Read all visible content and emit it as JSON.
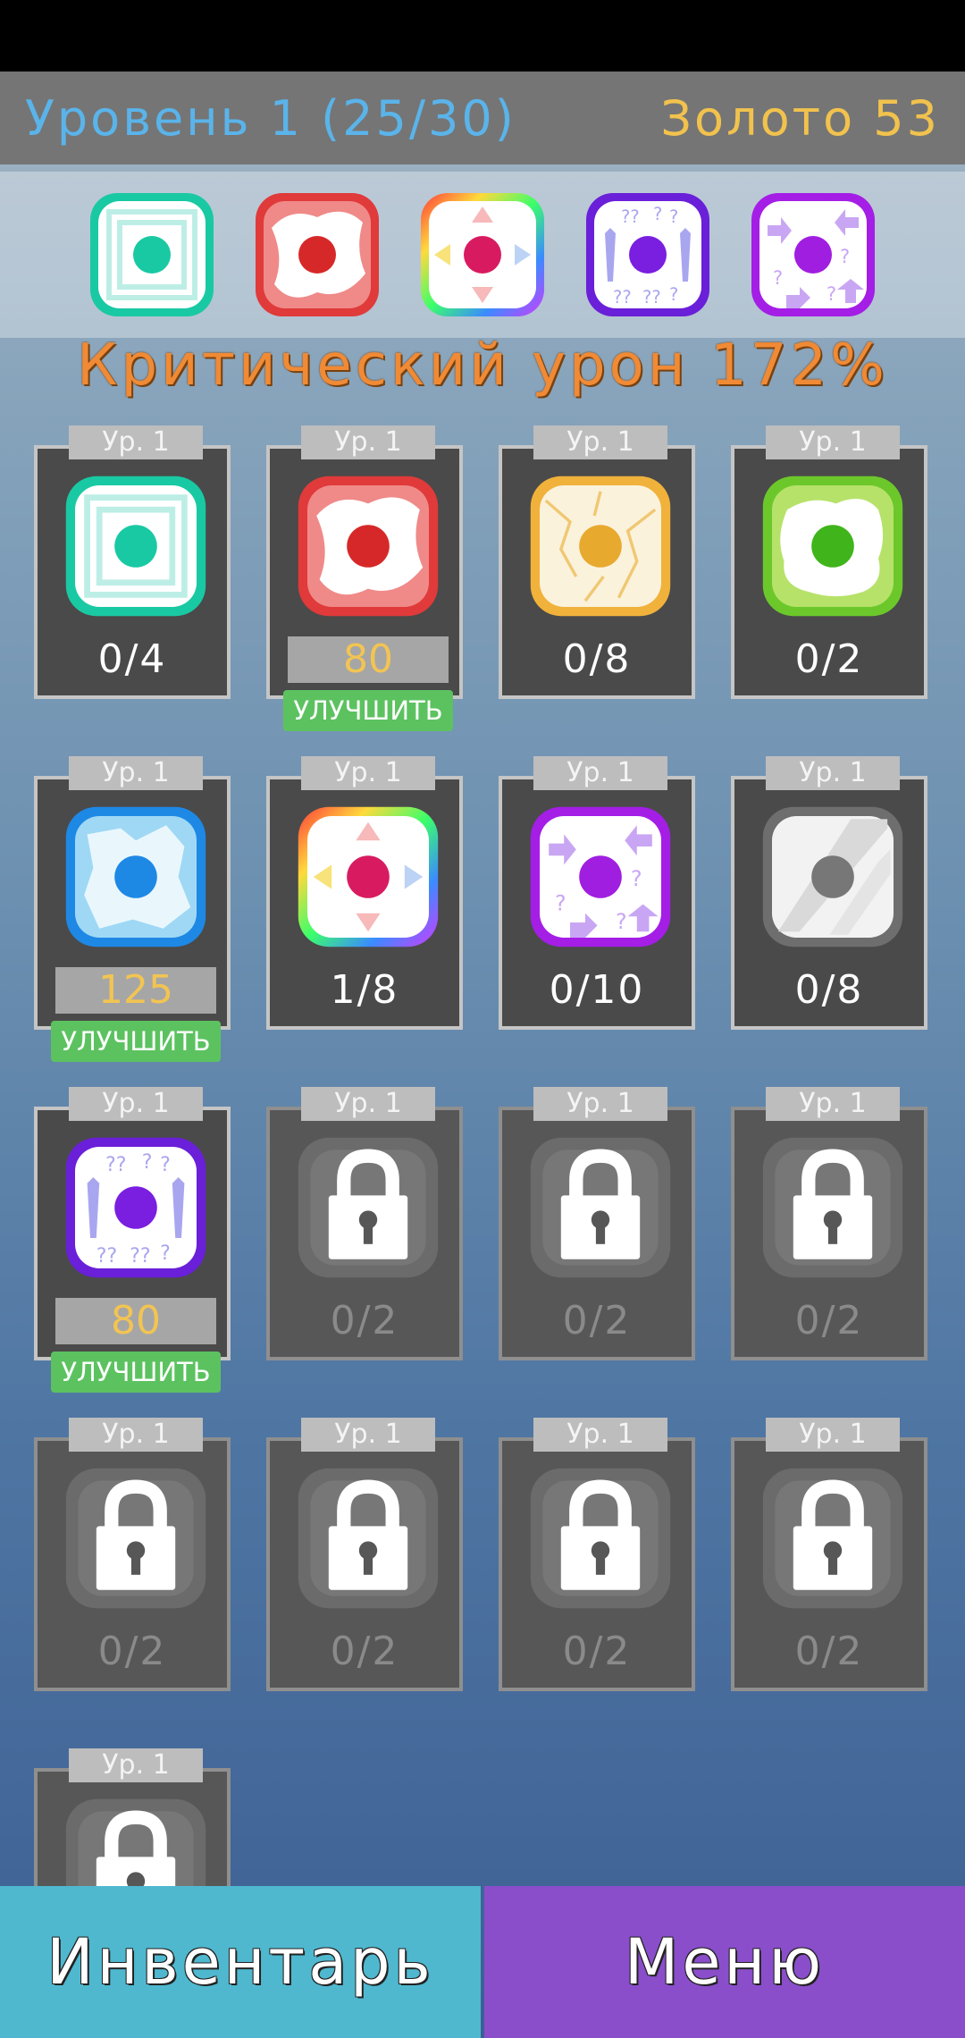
{
  "header": {
    "level_text": "Уровень 1 (25/30)",
    "gold_text": "Золото 53"
  },
  "equipped": [
    "cyan-frame-die",
    "red-flame-die",
    "rainbow-arrows-die",
    "blue-swords-question-die",
    "purple-arrows-question-die"
  ],
  "stat_title": "Критический урон 172%",
  "cards": [
    {
      "level": "Ур. 1",
      "icon": "cyan-frame-die",
      "count": "0/4",
      "locked": false
    },
    {
      "level": "Ур. 1",
      "icon": "red-flame-die",
      "cost": "80",
      "upgrade": "УЛУЧШИТЬ",
      "locked": false
    },
    {
      "level": "Ур. 1",
      "icon": "orange-crack-die",
      "count": "0/8",
      "locked": false
    },
    {
      "level": "Ур. 1",
      "icon": "green-splash-die",
      "count": "0/2",
      "locked": false
    },
    {
      "level": "Ур. 1",
      "icon": "blue-ice-die",
      "cost": "125",
      "upgrade": "УЛУЧШИТЬ",
      "locked": false
    },
    {
      "level": "Ур. 1",
      "icon": "rainbow-arrows-die",
      "count": "1/8",
      "locked": false
    },
    {
      "level": "Ур. 1",
      "icon": "purple-arrows-question-die",
      "count": "0/10",
      "locked": false
    },
    {
      "level": "Ур. 1",
      "icon": "grey-glass-die",
      "count": "0/8",
      "locked": false
    },
    {
      "level": "Ур. 1",
      "icon": "blue-swords-question-die",
      "cost": "80",
      "upgrade": "УЛУЧШИТЬ",
      "locked": false
    },
    {
      "level": "Ур. 1",
      "icon": "padlock-icon",
      "count": "0/2",
      "locked": true
    },
    {
      "level": "Ур. 1",
      "icon": "padlock-icon",
      "count": "0/2",
      "locked": true
    },
    {
      "level": "Ур. 1",
      "icon": "padlock-icon",
      "count": "0/2",
      "locked": true
    },
    {
      "level": "Ур. 1",
      "icon": "padlock-icon",
      "count": "0/2",
      "locked": true
    },
    {
      "level": "Ур. 1",
      "icon": "padlock-icon",
      "count": "0/2",
      "locked": true
    },
    {
      "level": "Ур. 1",
      "icon": "padlock-icon",
      "count": "0/2",
      "locked": true
    },
    {
      "level": "Ур. 1",
      "icon": "padlock-icon",
      "count": "0/2",
      "locked": true
    },
    {
      "level": "Ур. 1",
      "icon": "padlock-icon",
      "count": "",
      "locked": true
    }
  ],
  "bottom": {
    "inventory": "Инвентарь",
    "menu": "Меню"
  },
  "colors": {
    "cyan": "#19c9a3",
    "red": "#e03a3a",
    "orange": "#f0b23a",
    "green": "#6cc82a",
    "blue": "#1e88e5",
    "purple": "#8a1ee0",
    "grey": "#9e9e9e"
  }
}
